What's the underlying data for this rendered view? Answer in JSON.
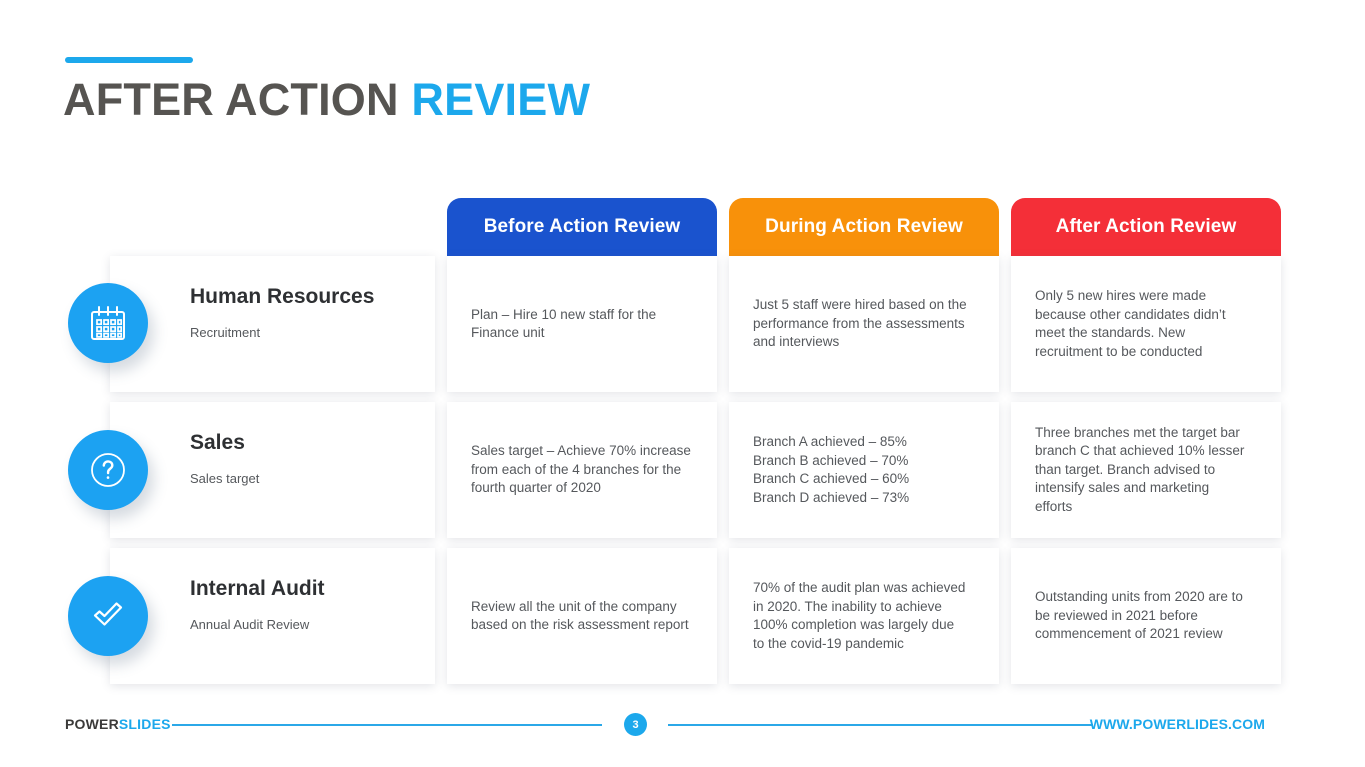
{
  "title": {
    "main": "AFTER ACTION ",
    "accent": "REVIEW"
  },
  "colors": {
    "accent_blue": "#1CA8EC",
    "icon_blue": "#1CA2F2",
    "tab_before": "#1A53CE",
    "tab_during": "#F8910A",
    "tab_after": "#F42F38",
    "title_gray": "#565451",
    "body_gray": "#55585C"
  },
  "columns": [
    {
      "label": "Before Action Review"
    },
    {
      "label": "During Action Review"
    },
    {
      "label": "After Action Review"
    }
  ],
  "rows": [
    {
      "icon": "calendar-icon",
      "title": "Human Resources",
      "subtitle": "Recruitment",
      "cells": [
        {
          "lines": [
            "Plan – Hire 10 new staff for the",
            "Finance unit"
          ]
        },
        {
          "lines": [
            "Just 5 staff were hired based on the",
            "performance from the assessments",
            "and interviews"
          ]
        },
        {
          "lines": [
            "Only 5 new hires were made",
            "because other candidates didn’t",
            "meet the standards. New",
            "recruitment to be conducted"
          ]
        }
      ]
    },
    {
      "icon": "question-mark-icon",
      "title": "Sales",
      "subtitle": "Sales target",
      "cells": [
        {
          "lines": [
            "Sales target – Achieve 70% increase",
            "from each of the 4 branches for the",
            "fourth quarter of 2020"
          ]
        },
        {
          "lines": [
            "Branch A achieved – 85%",
            "Branch B achieved – 70%",
            "Branch C achieved – 60%",
            "Branch D achieved – 73%"
          ]
        },
        {
          "lines": [
            "Three branches met the target bar",
            "branch C that achieved 10% lesser",
            "than target. Branch advised to",
            "intensify sales and marketing",
            "efforts"
          ]
        }
      ]
    },
    {
      "icon": "check-mark-icon",
      "title": "Internal Audit",
      "subtitle": "Annual Audit Review",
      "cells": [
        {
          "lines": [
            "Review all the unit of the company",
            "based on the risk assessment report"
          ]
        },
        {
          "lines": [
            "70% of the audit plan was achieved",
            "in 2020. The inability to achieve",
            "100% completion was largely due",
            "to the covid-19 pandemic"
          ]
        },
        {
          "lines": [
            "Outstanding units from 2020 are to",
            "be reviewed in 2021 before",
            "commencement of 2021 review"
          ]
        }
      ]
    }
  ],
  "footer": {
    "logo_bold": "POWER",
    "logo_accent": "SLIDES",
    "page_number": "3",
    "url": "WWW.POWERLIDES.COM"
  }
}
